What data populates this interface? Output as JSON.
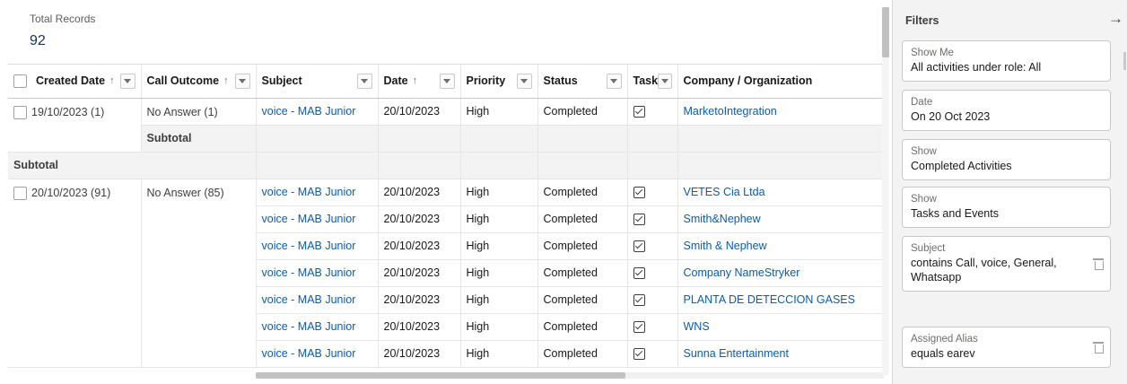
{
  "summary": {
    "label": "Total Records",
    "value": "92"
  },
  "columns": [
    {
      "label": "Created Date",
      "sort": "↑",
      "filter": true,
      "checkbox": true
    },
    {
      "label": "Call Outcome",
      "sort": "↑",
      "filter": true
    },
    {
      "label": "Subject",
      "sort": "",
      "filter": true
    },
    {
      "label": "Date",
      "sort": "↑",
      "filter": true
    },
    {
      "label": "Priority",
      "sort": "",
      "filter": true
    },
    {
      "label": "Status",
      "sort": "",
      "filter": true
    },
    {
      "label": "Task",
      "sort": "",
      "filter": true
    },
    {
      "label": "Company / Organization",
      "sort": "",
      "filter": false
    }
  ],
  "group1": {
    "created": "19/10/2023 (1)",
    "outcome": "No Answer (1)",
    "rows": [
      {
        "subject": "voice - MAB Junior",
        "date": "20/10/2023",
        "priority": "High",
        "status": "Completed",
        "company": "MarketoIntegration"
      }
    ],
    "inner_subtotal": "Subtotal",
    "outer_subtotal": "Subtotal"
  },
  "group2": {
    "created": "20/10/2023 (91)",
    "outcome": "No Answer (85)",
    "rows": [
      {
        "subject": "voice - MAB Junior",
        "date": "20/10/2023",
        "priority": "High",
        "status": "Completed",
        "company": "VETES Cia Ltda"
      },
      {
        "subject": "voice - MAB Junior",
        "date": "20/10/2023",
        "priority": "High",
        "status": "Completed",
        "company": "Smith&Nephew"
      },
      {
        "subject": "voice - MAB Junior",
        "date": "20/10/2023",
        "priority": "High",
        "status": "Completed",
        "company": "Smith & Nephew"
      },
      {
        "subject": "voice - MAB Junior",
        "date": "20/10/2023",
        "priority": "High",
        "status": "Completed",
        "company": "Company NameStryker"
      },
      {
        "subject": "voice - MAB Junior",
        "date": "20/10/2023",
        "priority": "High",
        "status": "Completed",
        "company": "PLANTA DE DETECCION GASES"
      },
      {
        "subject": "voice - MAB Junior",
        "date": "20/10/2023",
        "priority": "High",
        "status": "Completed",
        "company": "WNS"
      },
      {
        "subject": "voice - MAB Junior",
        "date": "20/10/2023",
        "priority": "High",
        "status": "Completed",
        "company": "Sunna Entertainment"
      }
    ]
  },
  "filters": {
    "title": "Filters",
    "items": [
      {
        "label": "Show Me",
        "value": "All activities under role: All",
        "removable": false
      },
      {
        "label": "Date",
        "value": "On 20 Oct 2023",
        "removable": false
      },
      {
        "label": "Show",
        "value": "Completed Activities",
        "removable": false
      },
      {
        "label": "Show",
        "value": "Tasks and Events",
        "removable": false
      },
      {
        "label": "Subject",
        "value": "contains Call, voice, General, Whatsapp",
        "removable": true
      },
      {
        "label": "Assigned Alias",
        "value": "equals earev",
        "removable": true
      }
    ]
  },
  "icons": {
    "sort": "arrow-up-icon",
    "filter": "chevron-down-icon",
    "collapse": "arrow-right-icon",
    "remove": "trash-icon",
    "task": "checkbox-checked-icon"
  },
  "colors": {
    "link": "#0b5cab",
    "subtotal_bg": "#f3f3f3",
    "panel_bg": "#f3f3f3"
  }
}
